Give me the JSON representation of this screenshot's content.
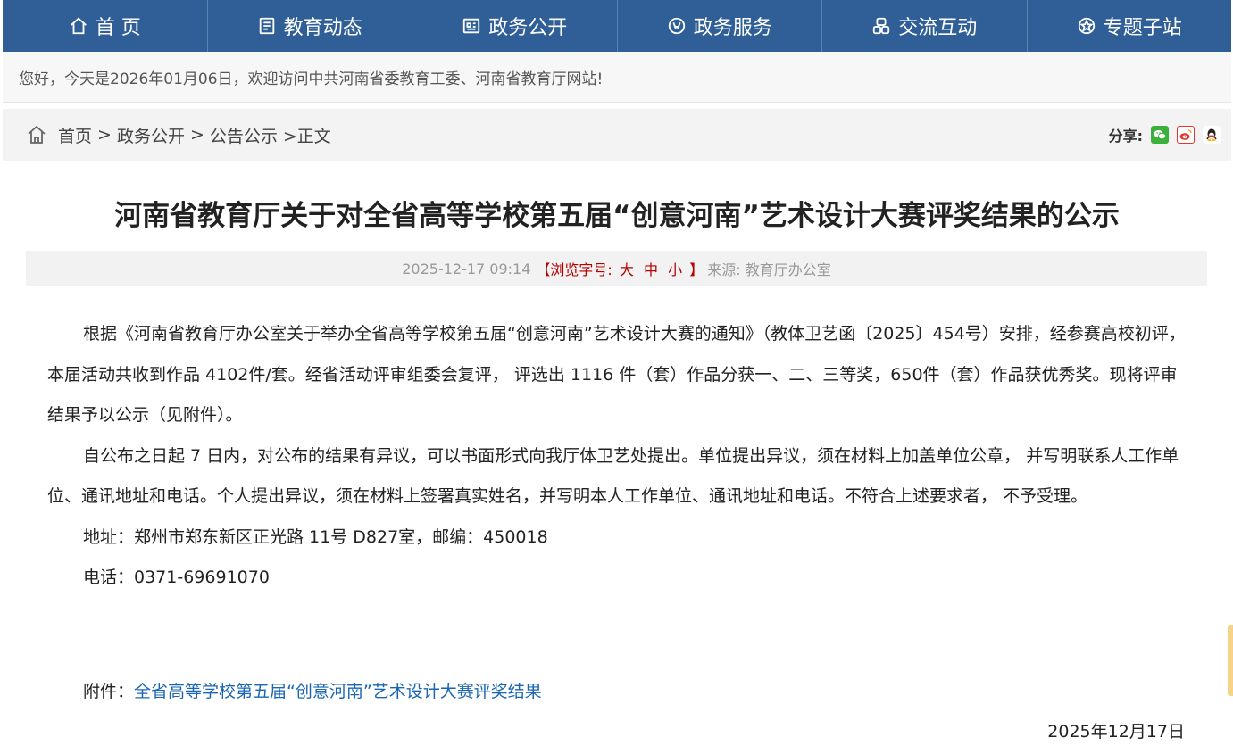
{
  "nav": {
    "items": [
      {
        "label": "首 页",
        "icon": "home-icon"
      },
      {
        "label": "教育动态",
        "icon": "news-icon"
      },
      {
        "label": "政务公开",
        "icon": "gov-open-icon"
      },
      {
        "label": "政务服务",
        "icon": "service-icon"
      },
      {
        "label": "交流互动",
        "icon": "interaction-icon"
      },
      {
        "label": "专题子站",
        "icon": "topic-icon"
      }
    ]
  },
  "welcome": "您好，今天是2026年01月06日，欢迎访问中共河南省委教育工委、河南省教育厅网站!",
  "breadcrumb": {
    "home": "首页",
    "sep": ">",
    "level2": "政务公开",
    "level3": "公告公示",
    "current": ">正文"
  },
  "share": {
    "label": "分享:",
    "icons": [
      "wechat-icon",
      "weibo-icon",
      "qq-icon"
    ],
    "colors": {
      "wechat": "#3bb03b",
      "weibo": "#e2372f",
      "qq": "#1e9adf"
    }
  },
  "article": {
    "title": "河南省教育厅关于对全省高等学校第五届“创意河南”艺术设计大赛评奖结果的公示",
    "datetime": "2025-12-17 09:14",
    "font_label_open": "【浏览字号:",
    "font_large": "大",
    "font_medium": "中",
    "font_small": "小",
    "font_label_close": "】",
    "source": "来源:  教育厅办公室",
    "paragraphs": [
      "根据《河南省教育厅办公室关于举办全省高等学校第五届“创意河南”艺术设计大赛的通知》（教体卫艺函〔2025〕454号）安排，经参赛高校初评，本届活动共收到作品 4102件/套。经省活动评审组委会复评， 评选出 1116 件（套）作品分获一、二、三等奖，650件（套）作品获优秀奖。现将评审结果予以公示（见附件）。",
      "自公布之日起 7 日内，对公布的结果有异议，可以书面形式向我厅体卫艺处提出。单位提出异议，须在材料上加盖单位公章， 并写明联系人工作单位、通讯地址和电话。个人提出异议，须在材料上签署真实姓名，并写明本人工作单位、通讯地址和电话。不符合上述要求者， 不予受理。",
      "地址：郑州市郑东新区正光路 11号 D827室，邮编：450018",
      "电话：0371-69691070"
    ],
    "attachment_label": "附件：",
    "attachment_link": "全省高等学校第五届“创意河南”艺术设计大赛评奖结果",
    "sign_date": "2025年12月17日"
  },
  "colors": {
    "nav_bg": "#2f5f96",
    "link": "#1a66b3",
    "font_size_accent": "#b50000"
  }
}
